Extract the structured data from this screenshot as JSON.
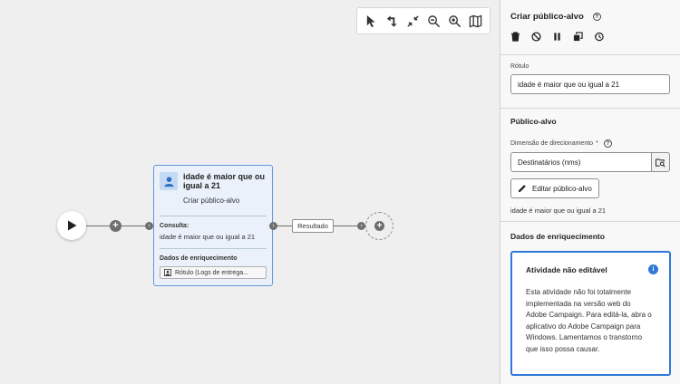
{
  "toolbar": {
    "tools": [
      "select-icon",
      "rotate-icon",
      "collapse-icon",
      "zoom-out-icon",
      "zoom-in-icon",
      "map-icon"
    ]
  },
  "node": {
    "title": "idade é maior que ou igual a 21",
    "subtitle": "Criar público-alvo",
    "query_label": "Consulta:",
    "query_text": "idade é maior que ou igual a 21",
    "enrichment_label": "Dados de enriquecimento",
    "enrichment_chip": "Rótulo (Logs de entrega..."
  },
  "transition": {
    "label": "Resultado"
  },
  "panel": {
    "title": "Criar público-alvo",
    "label_field": {
      "label": "Rótulo",
      "value": "idade é maior que ou igual a 21"
    },
    "audience": {
      "title": "Público-alvo",
      "dimension_label": "Dimensão de direcionamento",
      "dimension_value": "Destinatários (nms)",
      "edit_button": "Editar público-alvo",
      "query_summary": "idade é maior que ou igual a 21"
    },
    "enrichment": {
      "title": "Dados de enriquecimento",
      "info_title": "Atividade não editável",
      "info_body": "Esta atividade não foi totalmente implementada na versão web do Adobe Campaign. Para editá-la, abra o aplicativo do Adobe Campaign para Windows. Lamentamos o transtorno que isso possa causar."
    }
  },
  "colors": {
    "accent": "#2f79d6",
    "node_bg": "#eaf1fb",
    "node_border": "#5e99e0"
  }
}
